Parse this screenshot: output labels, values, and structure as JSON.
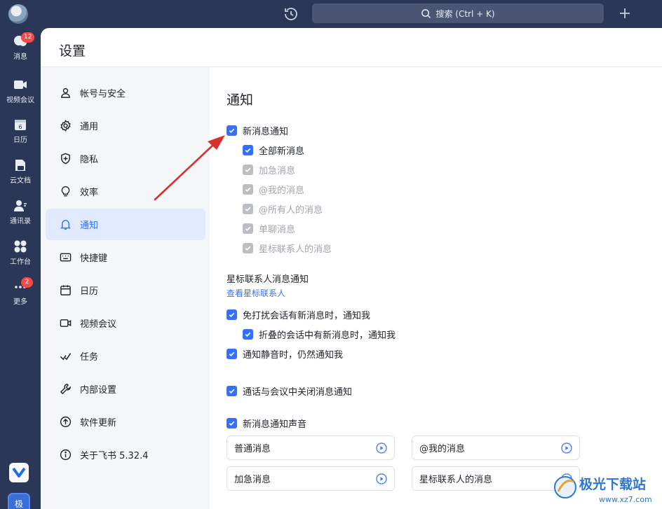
{
  "topbar": {
    "search_placeholder": "搜索 (Ctrl + K)"
  },
  "rail": {
    "items": [
      {
        "label": "消息",
        "badge": "12",
        "icon": "chat-bubble-icon"
      },
      {
        "label": "视频会议",
        "icon": "video-camera-icon"
      },
      {
        "label": "日历",
        "icon": "calendar-icon",
        "day": "6"
      },
      {
        "label": "云文档",
        "icon": "document-icon"
      },
      {
        "label": "通讯录",
        "icon": "contacts-icon"
      },
      {
        "label": "工作台",
        "icon": "workplace-icon"
      },
      {
        "label": "更多",
        "badge": "2",
        "icon": "more-icon"
      }
    ],
    "me_label": "极"
  },
  "window": {
    "title": "设置"
  },
  "nav": {
    "items": [
      {
        "label": "帐号与安全",
        "icon": "user-icon"
      },
      {
        "label": "通用",
        "icon": "gear-icon"
      },
      {
        "label": "隐私",
        "icon": "shield-icon"
      },
      {
        "label": "效率",
        "icon": "lightbulb-icon"
      },
      {
        "label": "通知",
        "icon": "bell-icon",
        "active": true
      },
      {
        "label": "快捷键",
        "icon": "keyboard-icon"
      },
      {
        "label": "日历",
        "icon": "calendar-icon"
      },
      {
        "label": "视频会议",
        "icon": "video-icon"
      },
      {
        "label": "任务",
        "icon": "task-check-icon"
      },
      {
        "label": "内部设置",
        "icon": "wrench-icon"
      },
      {
        "label": "软件更新",
        "icon": "update-arrow-icon"
      },
      {
        "label": "关于飞书 5.32.4",
        "icon": "info-icon"
      }
    ]
  },
  "notification": {
    "title": "通知",
    "new_message": "新消息通知",
    "all_new": "全部新消息",
    "sub_options": [
      "加急消息",
      "@我的消息",
      "@所有人的消息",
      "单聊消息",
      "星标联系人的消息"
    ],
    "star_title": "星标联系人消息通知",
    "star_link": "查看星标联系人",
    "dnd_notify": "免打扰会话有新消息时，通知我",
    "folded_notify": "折叠的会话中有新消息时，通知我",
    "mute_notify": "通知静音时，仍然通知我",
    "call_close": "通话与会议中关闭消息通知",
    "sound_title": "新消息通知声音",
    "sounds": [
      "普通消息",
      "@我的消息",
      "加急消息",
      "星标联系人的消息"
    ]
  },
  "watermark": {
    "text": "极光下载站",
    "url": "www.xz7.com"
  },
  "colors": {
    "accent": "#3370ff",
    "rail_bg": "#2b3757",
    "annotation_arrow": "#d9302c"
  }
}
